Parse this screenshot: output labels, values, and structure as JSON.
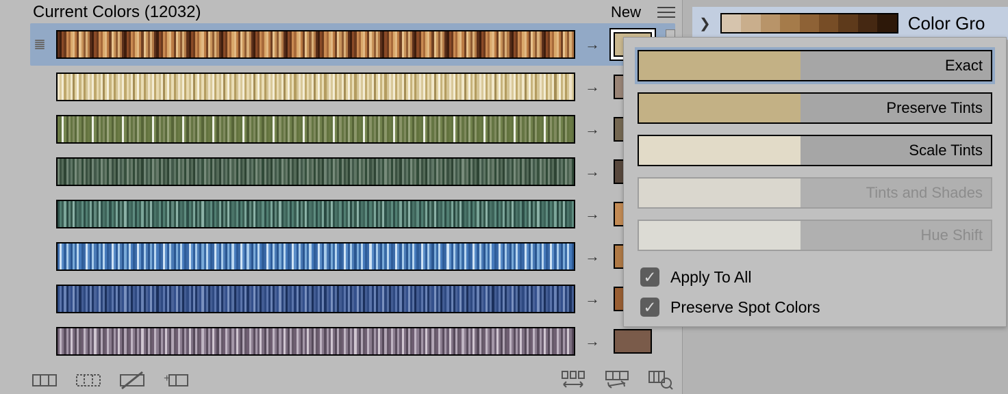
{
  "header": {
    "title": "Current Colors (12032)",
    "new": "New"
  },
  "rows": [
    {
      "selected": true,
      "swatch": "#cbb990",
      "colors": [
        "#5a2f1a",
        "#3f1e0e",
        "#8a4a27",
        "#6b3a1d",
        "#c98a52",
        "#a86a3a",
        "#d9a86b",
        "#e2b983",
        "#bb7b44",
        "#704022",
        "#e7c38e",
        "#c8935a",
        "#8f5b33",
        "#d9b07a",
        "#b27946"
      ]
    },
    {
      "swatch": "#9a8577",
      "colors": [
        "#efe4c8",
        "#d9c99a",
        "#f3ecd4",
        "#bfa86c",
        "#e7d9af",
        "#cfbe8c",
        "#f0e7c9",
        "#a48d55",
        "#e0d1a0",
        "#f6f0dc",
        "#c7b37c",
        "#e9ddb6",
        "#b49c60",
        "#d4c494"
      ]
    },
    {
      "swatch": "#756852",
      "colors": [
        "#6b7a45",
        "#627341",
        "#eef0e6",
        "#75854f",
        "#4f5c33",
        "#8a9468",
        "#657543",
        "#7f8a5e",
        "#5a6a3b",
        "#9aa57c",
        "#71814c",
        "#566437",
        "#8c976b",
        "#63733f"
      ]
    },
    {
      "swatch": "#58483d",
      "colors": [
        "#6f8372",
        "#3a5040",
        "#546a58",
        "#2e4434",
        "#708575",
        "#42594a",
        "#5f7665",
        "#37503e",
        "#788c7b",
        "#4b6250",
        "#667a69",
        "#314a38"
      ]
    },
    {
      "swatch": "#c38b55",
      "colors": [
        "#2d4e47",
        "#517e72",
        "#3a5e54",
        "#7ca69a",
        "#2a4a42",
        "#62897e",
        "#34574c",
        "#8bb1a6",
        "#2f524a",
        "#4a7368",
        "#3d6359",
        "#5f8c80"
      ]
    },
    {
      "swatch": "#b07a46",
      "colors": [
        "#3b6aa8",
        "#cfe3f5",
        "#5a8dc8",
        "#2f5e9c",
        "#a8cbea",
        "#4a7ab5",
        "#2a5690",
        "#7aaad8",
        "#386aa6",
        "#b9d6ef",
        "#467abb",
        "#2e5c98"
      ]
    },
    {
      "swatch": "#9a5f33",
      "colors": [
        "#2f4a82",
        "#5a74ab",
        "#243d72",
        "#6a83b5",
        "#1f3666",
        "#4a6399",
        "#34508c",
        "#7a91bf",
        "#2a447a",
        "#5670a3",
        "#1b305c",
        "#425c93"
      ]
    },
    {
      "swatch": "#7a5b4a",
      "colors": [
        "#6f5f72",
        "#bfb4c2",
        "#8a7c8e",
        "#5a4d5e",
        "#a497a8",
        "#6b5d70",
        "#cfc5d0",
        "#7e7082",
        "#564a5a",
        "#b2a6b5",
        "#655868"
      ]
    }
  ],
  "popup": {
    "options": [
      {
        "label": "Exact",
        "fill": "#c3b185",
        "selected": true,
        "disabled": false
      },
      {
        "label": "Preserve Tints",
        "fill": "#c3b185",
        "selected": false,
        "disabled": false
      },
      {
        "label": "Scale Tints",
        "fill": "#e2dbc8",
        "selected": false,
        "disabled": false
      },
      {
        "label": "Tints and Shades",
        "fill": "#ece7d8",
        "selected": false,
        "disabled": true
      },
      {
        "label": "Hue Shift",
        "fill": "#f0ede2",
        "selected": false,
        "disabled": true
      }
    ],
    "c1": "Apply To All",
    "c2": "Preserve Spot Colors"
  },
  "right": {
    "label": "Color Gro",
    "grad": [
      "#d6c4ad",
      "#c9ae8c",
      "#b89469",
      "#a57b4a",
      "#8e6236",
      "#774d26",
      "#5e3a1b",
      "#452812",
      "#2d1809"
    ]
  }
}
